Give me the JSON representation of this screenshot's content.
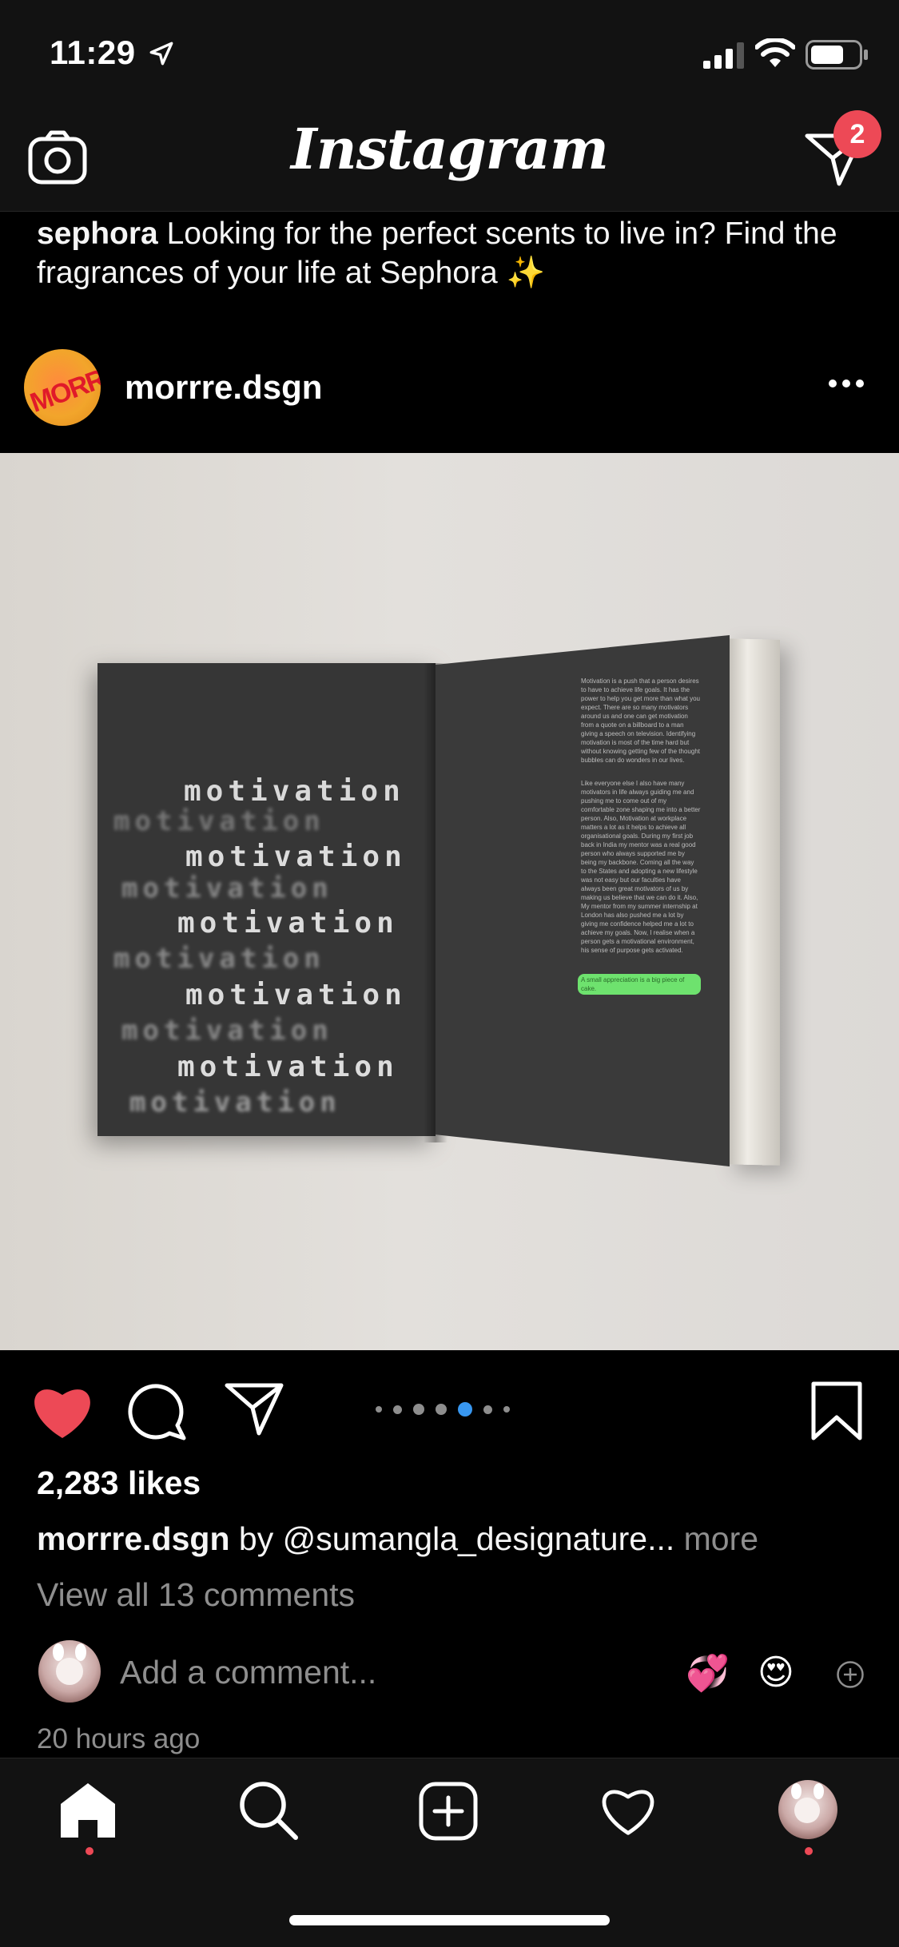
{
  "status": {
    "time": "11:29"
  },
  "header": {
    "brand": "Instagram",
    "dm_badge": "2"
  },
  "prev_post": {
    "username": "sephora",
    "caption": "Looking for the perfect scents to live in? Find the fragrances of your life at Sephora ✨"
  },
  "post": {
    "username": "morrre.dsgn",
    "avatar_text": "MORRE",
    "image": {
      "art_word": "motivation",
      "page_text": "Motivation is a push that a person desires to have to achieve life goals. It has the power to help you get more than what you expect. There are so many motivators around us and one can get motivation from a quote on a billboard to a man giving a speech on television. Identifying motivation is most of the time hard but without knowing getting few of the thought bubbles can do wonders in our lives.",
      "page_text_2": "Like everyone else I also have many motivators in life always guiding me and pushing me to come out of my comfortable zone shaping me into a better person. Also, Motivation at workplace matters a lot as it helps to achieve all organisational goals. During my first job back in India my mentor was a real good person who always supported me by being my backbone. Coming all the way to the States and adopting a new lifestyle was not easy but our faculties have always been great motivators of us by making us believe that we can do it. Also, My mentor from my summer internship at London has also pushed me a lot by giving me confidence helped me a lot to achieve my goals. Now, I realise when a person gets a motivational environment, his sense of purpose gets activated.",
      "highlight": "A small appreciation is a big piece of cake."
    },
    "likes": "2,283 likes",
    "caption_user": "morrre.dsgn",
    "caption_text": "by @sumangla_designature...",
    "caption_more": "more",
    "view_comments": "View all 13 comments",
    "comment_placeholder": "Add a comment...",
    "quick_emojis": [
      "💞",
      "😍"
    ],
    "time_ago": "20 hours ago",
    "carousel": {
      "count": 7,
      "active_index": 4
    }
  }
}
